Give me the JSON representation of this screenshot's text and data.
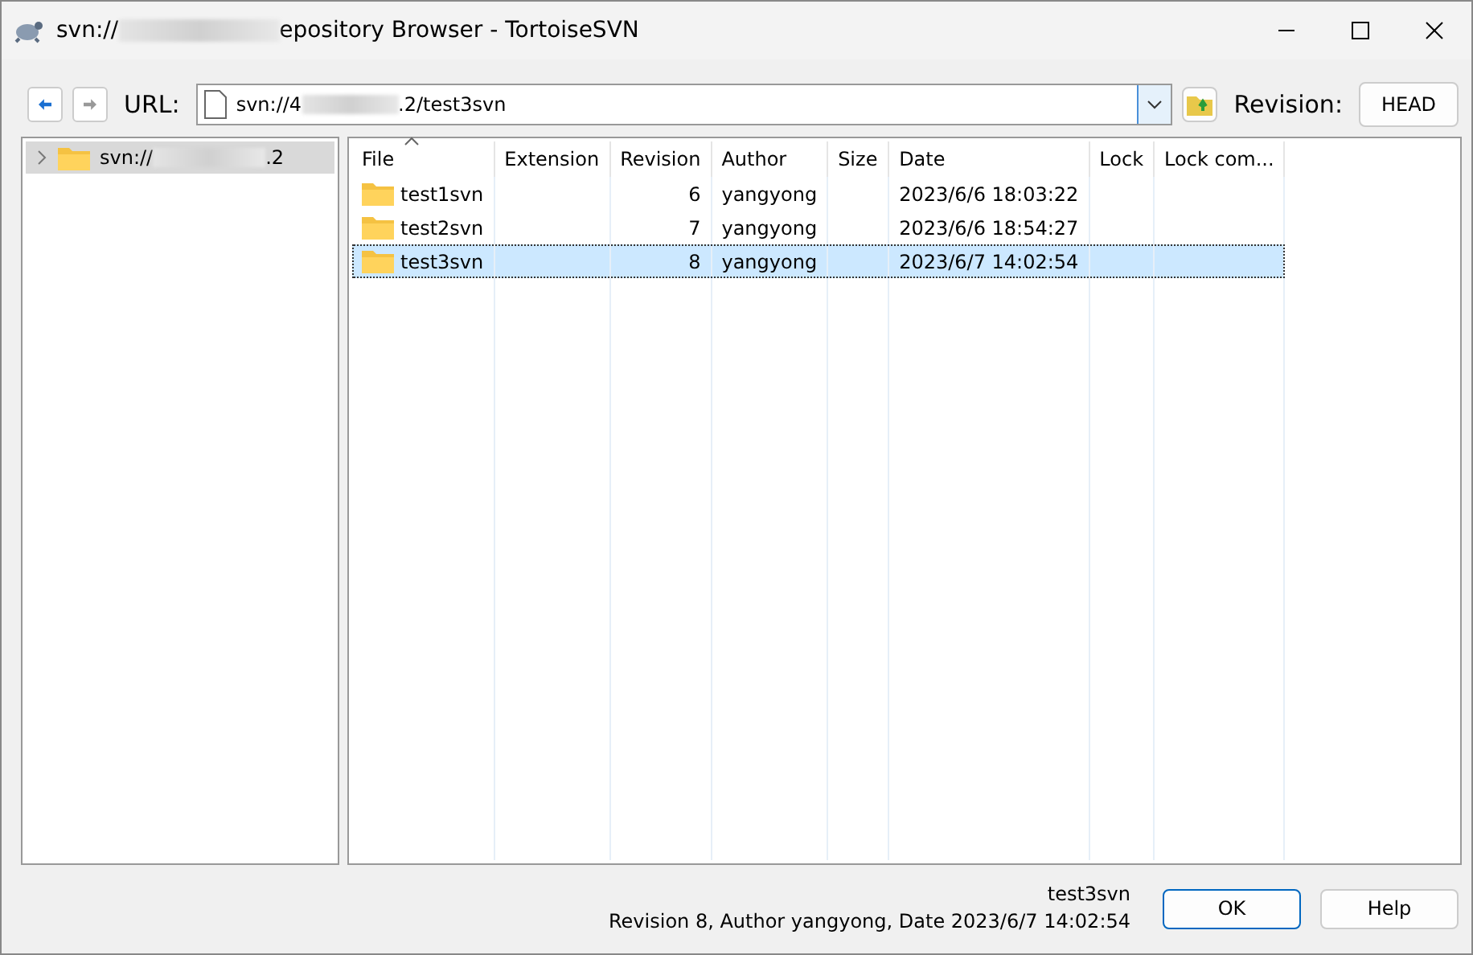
{
  "window": {
    "title_prefix": "svn://",
    "title_suffix": "epository Browser - TortoiseSVN"
  },
  "toolbar": {
    "url_label": "URL:",
    "url_prefix": "svn://4",
    "url_suffix": ".2/test3svn",
    "revision_label": "Revision:",
    "revision_button": "HEAD"
  },
  "tree": {
    "items": [
      {
        "prefix": "svn://",
        "suffix": ".2",
        "selected": true,
        "expanded": false
      }
    ]
  },
  "table": {
    "columns": [
      "File",
      "Extension",
      "Revision",
      "Author",
      "Size",
      "Date",
      "Lock",
      "Lock com..."
    ],
    "rows": [
      {
        "name": "test1svn",
        "revision": "6",
        "author": "yangyong",
        "date": "2023/6/6 18:03:22",
        "selected": false
      },
      {
        "name": "test2svn",
        "revision": "7",
        "author": "yangyong",
        "date": "2023/6/6 18:54:27",
        "selected": false
      },
      {
        "name": "test3svn",
        "revision": "8",
        "author": "yangyong",
        "date": "2023/6/7 14:02:54",
        "selected": true
      }
    ]
  },
  "status": {
    "line_1": "test3svn",
    "line_2": "Revision 8, Author yangyong, Date 2023/6/7 14:02:54"
  },
  "buttons": [
    {
      "label": "OK",
      "kind": "default"
    },
    {
      "label": "Help",
      "kind": "normal"
    }
  ]
}
